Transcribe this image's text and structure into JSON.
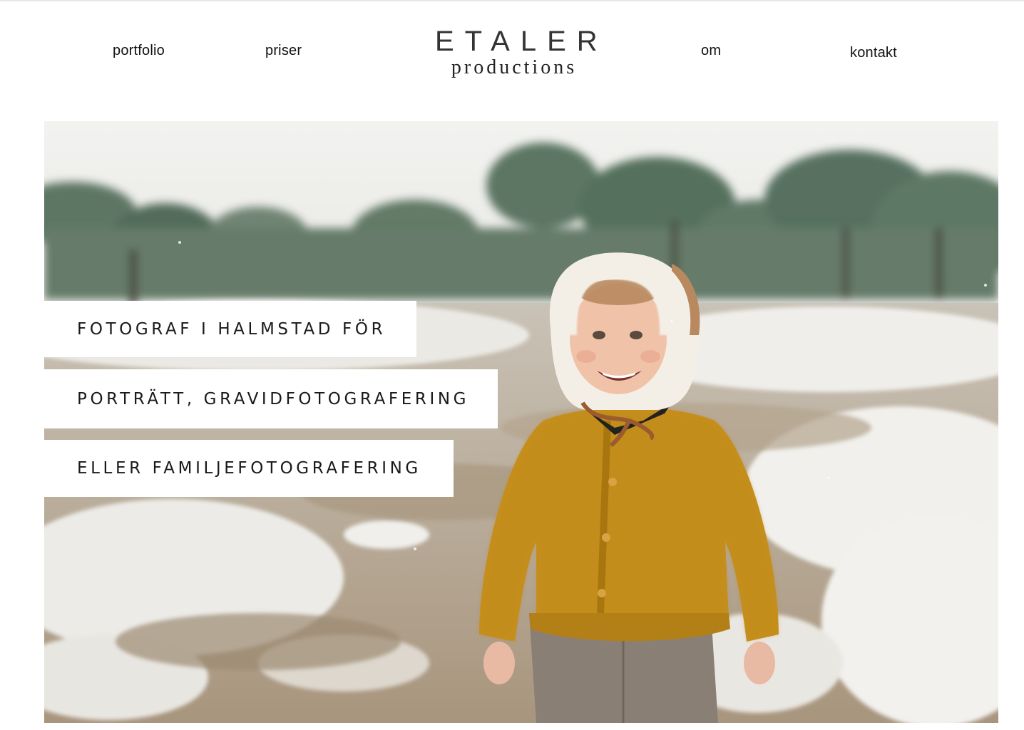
{
  "header": {
    "nav_left": [
      {
        "label": "portfolio"
      },
      {
        "label": "priser"
      }
    ],
    "logo": {
      "line1": "ETALER",
      "line2": "productions"
    },
    "nav_right": [
      {
        "label": "om"
      },
      {
        "label": "kontakt"
      }
    ]
  },
  "hero": {
    "image": "photo of a smiling toddler in a mustard knit cardigan and sherpa bonnet on snowy heathland with pine trees",
    "taglines": [
      "FOTOGRAF I HALMSTAD FÖR",
      "PORTRÄTT, GRAVIDFOTOGRAFERING",
      "ELLER FAMILJEFOTOGRAFERING"
    ]
  },
  "colors": {
    "background": "#ffffff",
    "text": "#111111",
    "tag_background": "#ffffff",
    "cardigan": "#c8921e",
    "snow": "#eeeeea",
    "trees": "#4e6a55"
  }
}
